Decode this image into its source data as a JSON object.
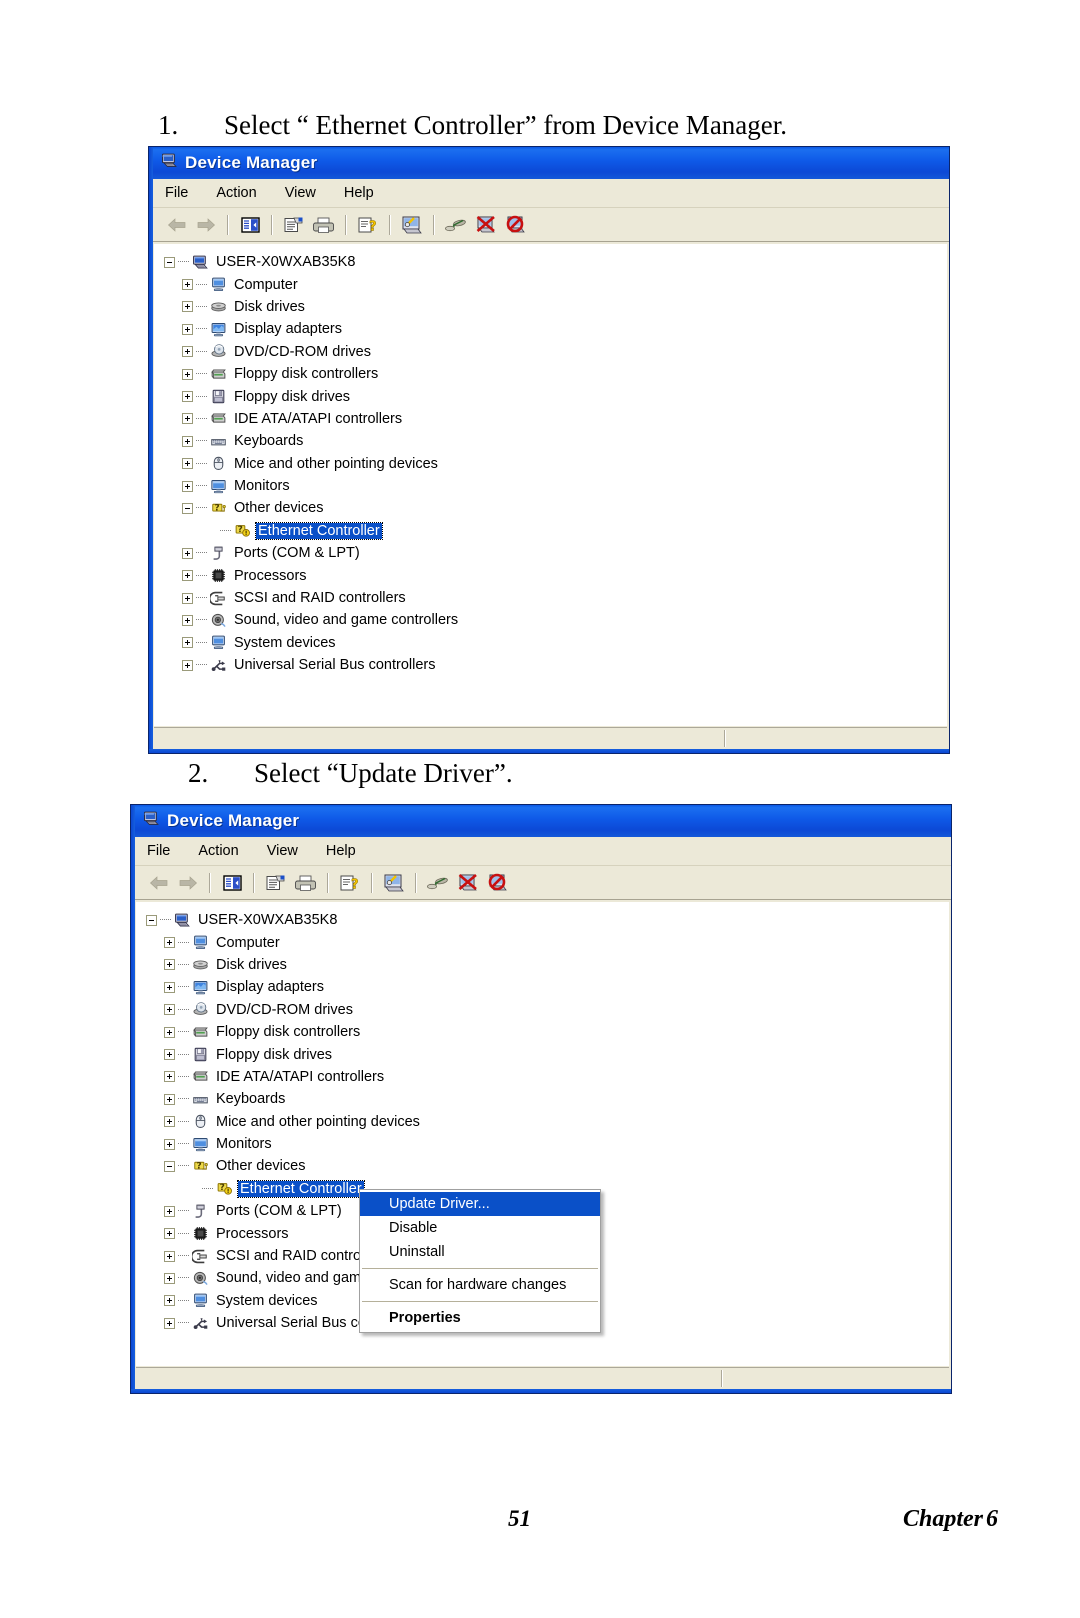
{
  "document": {
    "steps": [
      {
        "number": "1.",
        "text": "Select “ Ethernet Controller” from Device Manager."
      },
      {
        "number": "2.",
        "text": "Select “Update Driver”."
      }
    ],
    "footer": {
      "page_number": "51",
      "chapter_label": "Chapter",
      "chapter_number": "6"
    }
  },
  "window": {
    "title": "Device Manager",
    "menu": [
      "File",
      "Action",
      "View",
      "Help"
    ],
    "toolbar_icons": [
      "back-arrow-icon",
      "forward-arrow-icon",
      "show-hide-tree-icon",
      "properties-icon",
      "print-icon",
      "help-icon",
      "scan-hardware-icon",
      "update-driver-icon",
      "disable-device-icon",
      "uninstall-device-icon"
    ]
  },
  "tree": {
    "root": {
      "label": "USER-X0WXAB35K8",
      "icon": "computer-icon",
      "expander": "minus"
    },
    "nodes": [
      {
        "label": "Computer",
        "icon": "computer-node-icon",
        "expander": "plus"
      },
      {
        "label": "Disk drives",
        "icon": "disk-drive-icon",
        "expander": "plus"
      },
      {
        "label": "Display adapters",
        "icon": "display-adapter-icon",
        "expander": "plus"
      },
      {
        "label": "DVD/CD-ROM drives",
        "icon": "dvd-drive-icon",
        "expander": "plus"
      },
      {
        "label": "Floppy disk controllers",
        "icon": "floppy-controller-icon",
        "expander": "plus"
      },
      {
        "label": "Floppy disk drives",
        "icon": "floppy-drive-icon",
        "expander": "plus"
      },
      {
        "label": "IDE ATA/ATAPI controllers",
        "icon": "ide-controller-icon",
        "expander": "plus"
      },
      {
        "label": "Keyboards",
        "icon": "keyboard-icon",
        "expander": "plus"
      },
      {
        "label": "Mice and other pointing devices",
        "icon": "mouse-icon",
        "expander": "plus"
      },
      {
        "label": "Monitors",
        "icon": "monitor-icon",
        "expander": "plus"
      },
      {
        "label": "Other devices",
        "icon": "unknown-device-icon",
        "expander": "minus"
      },
      {
        "label": "Ethernet Controller",
        "icon": "warning-device-icon",
        "expander": "none",
        "child": true,
        "selected": true
      },
      {
        "label": "Ports (COM & LPT)",
        "icon": "port-icon",
        "expander": "plus"
      },
      {
        "label": "Processors",
        "icon": "processor-icon",
        "expander": "plus"
      },
      {
        "label": "SCSI and RAID controllers",
        "icon": "scsi-controller-icon",
        "expander": "plus"
      },
      {
        "label": "Sound, video and game controllers",
        "icon": "sound-device-icon",
        "expander": "plus"
      },
      {
        "label": "System devices",
        "icon": "system-device-icon",
        "expander": "plus"
      },
      {
        "label": "Universal Serial Bus controllers",
        "icon": "usb-controller-icon",
        "expander": "plus"
      }
    ]
  },
  "context_menu": {
    "items": [
      {
        "label": "Update Driver...",
        "highlighted": true
      },
      {
        "label": "Disable"
      },
      {
        "label": "Uninstall"
      },
      {
        "separator": true
      },
      {
        "label": "Scan for hardware changes"
      },
      {
        "separator": true
      },
      {
        "label": "Properties",
        "bold": true
      }
    ]
  },
  "colors": {
    "titlebar_blue": "#0c4fdc",
    "selection_blue": "#0a50c8",
    "chrome_beige": "#ece9d8",
    "frame_border": "#0a246a"
  }
}
